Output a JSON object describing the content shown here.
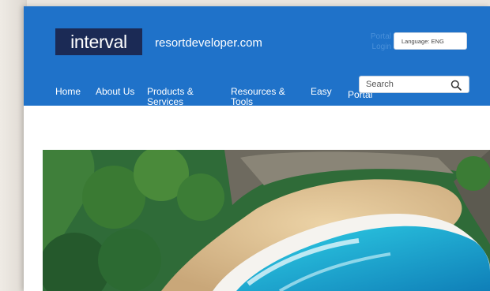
{
  "header": {
    "logo_text": "interval",
    "site_name": "resortdeveloper.com",
    "portal_line1": "Portal",
    "portal_line2": "Login",
    "language_label": "Language: ENG"
  },
  "nav": {
    "home": "Home",
    "about": "About Us",
    "products_line1": "Products &",
    "products_line2": "Services",
    "resources_line1": "Resources &",
    "resources_line2": "Tools",
    "easy": "Easy",
    "portal": "Portal"
  },
  "search": {
    "placeholder": "Search",
    "icon": "magnifier-icon"
  },
  "hero": {
    "image": "aerial-beach-cove-photo"
  },
  "colors": {
    "header_bg": "#1f72c9",
    "logo_bg": "#1b2a55",
    "portal_text": "#4a90d9"
  }
}
